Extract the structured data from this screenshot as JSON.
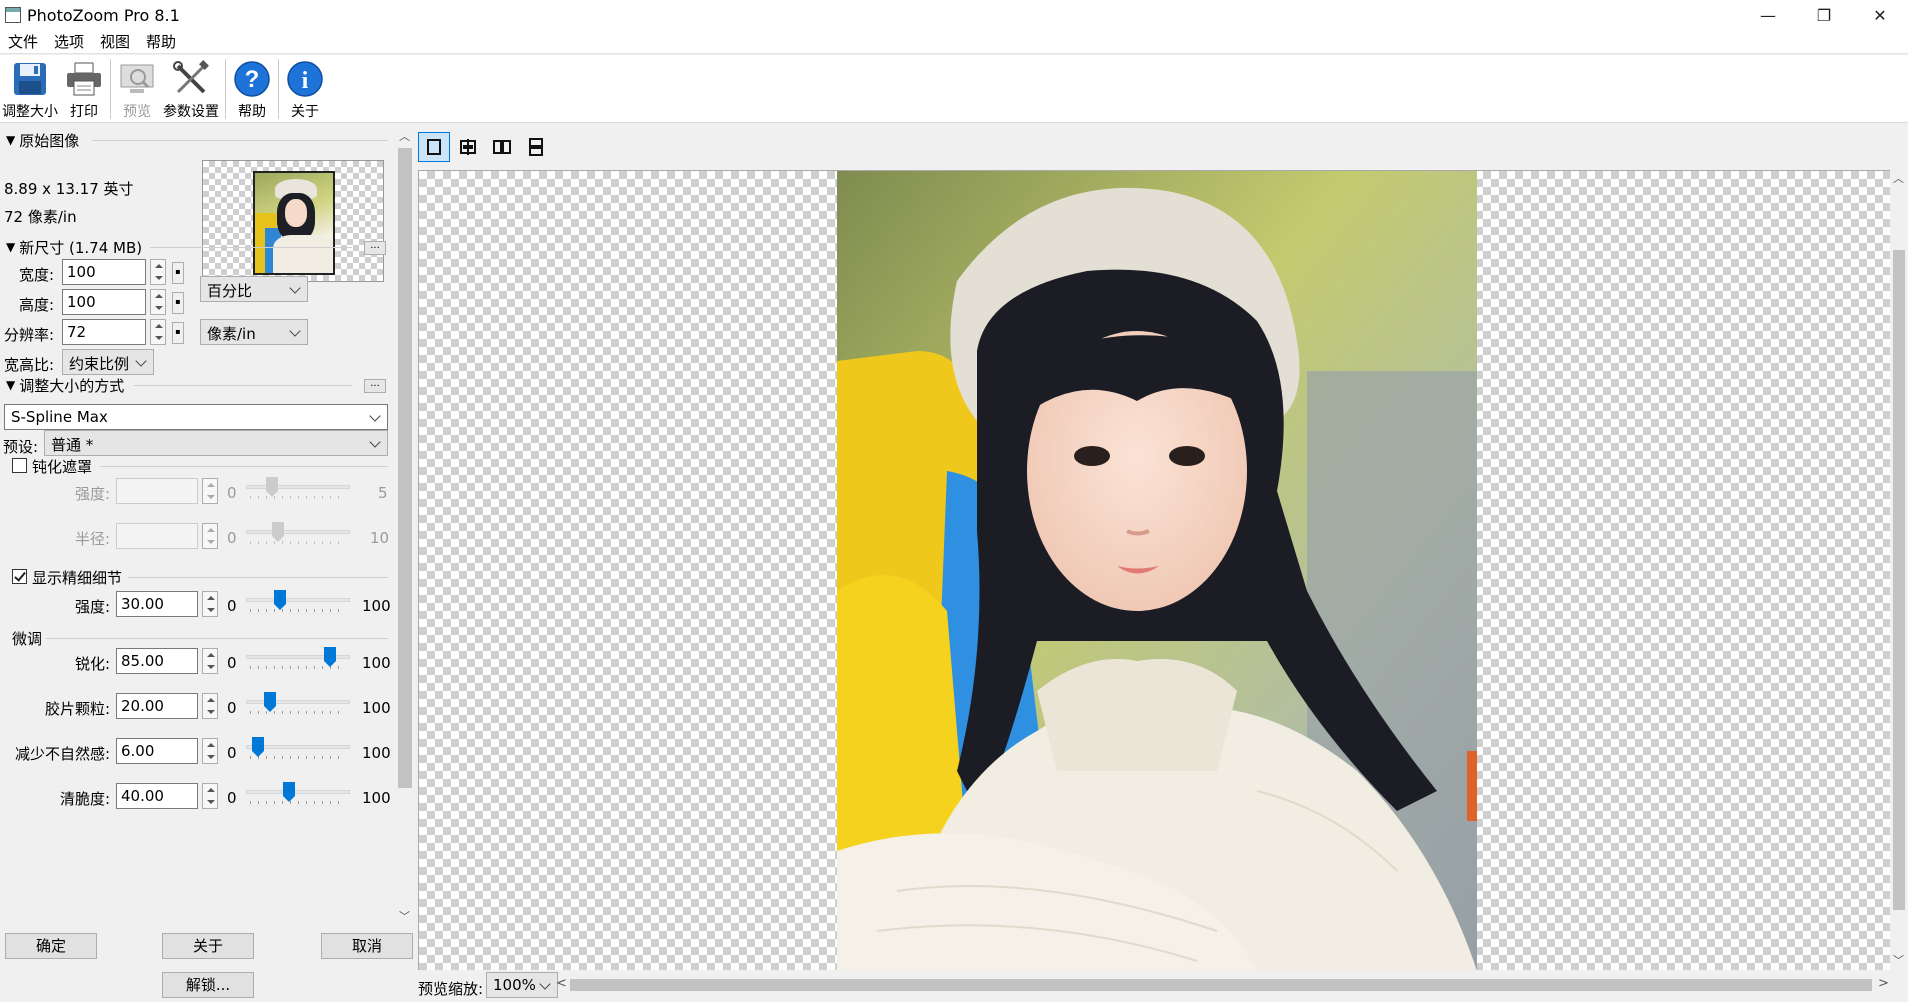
{
  "window": {
    "title": "PhotoZoom Pro 8.1",
    "min": "—",
    "max": "❐",
    "close": "✕"
  },
  "menu": [
    "文件",
    "选项",
    "视图",
    "帮助"
  ],
  "toolbar": {
    "resize": "调整大小",
    "print": "打印",
    "preview": "预览",
    "settings": "参数设置",
    "help": "帮助",
    "about": "关于"
  },
  "original": {
    "header": "原始图像",
    "size": "8.89 x 13.17 英寸",
    "resolution": "72 像素/in"
  },
  "new_size": {
    "header": "新尺寸 (1.74 MB)",
    "more": "...",
    "width_label": "宽度:",
    "width_value": "100",
    "height_label": "高度:",
    "height_value": "100",
    "res_label": "分辨率:",
    "res_value": "72",
    "unit": "百分比",
    "res_unit": "像素/in",
    "aspect_label": "宽高比:",
    "aspect_value": "约束比例"
  },
  "method": {
    "header": "调整大小的方式",
    "more": "...",
    "algorithm": "S-Spline Max",
    "preset_label": "预设:",
    "preset_value": "普通 *"
  },
  "unsharp": {
    "label": "钝化遮罩",
    "checked": false,
    "strength_label": "强度:",
    "strength_min": "0",
    "strength_max": "5",
    "radius_label": "半径:",
    "radius_min": "0",
    "radius_max": "10"
  },
  "detail": {
    "label": "显示精细细节",
    "checked": true,
    "strength_label": "强度:",
    "strength_value": "30.00",
    "min": "0",
    "max": "100",
    "level": 0.3
  },
  "fine_tune": {
    "header": "微调",
    "rows": [
      {
        "label": "锐化:",
        "value": "85.00",
        "min": "0",
        "max": "100",
        "level": 0.85
      },
      {
        "label": "胶片颗粒:",
        "value": "20.00",
        "min": "0",
        "max": "100",
        "level": 0.2
      },
      {
        "label": "减少不自然感:",
        "value": "6.00",
        "min": "0",
        "max": "100",
        "level": 0.06
      },
      {
        "label": "清脆度:",
        "value": "40.00",
        "min": "0",
        "max": "100",
        "level": 0.4
      }
    ]
  },
  "buttons": {
    "ok": "确定",
    "about": "关于",
    "cancel": "取消",
    "unlock": "解锁..."
  },
  "zoom": {
    "label": "预览缩放:",
    "value": "100%"
  },
  "colors": {
    "accent": "#0078d7",
    "checker": "#cfcfcf"
  }
}
